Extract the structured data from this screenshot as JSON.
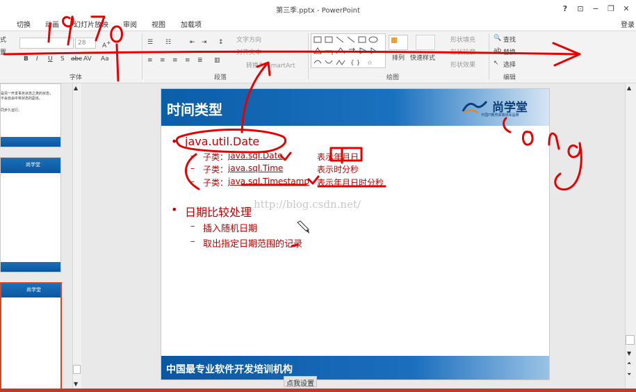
{
  "window": {
    "title": "第三季.pptx - PowerPoint",
    "help": "?",
    "login": "登录"
  },
  "tabs": [
    "切换",
    "动画",
    "幻灯片放映",
    "审阅",
    "视图",
    "加载项"
  ],
  "ribbon": {
    "font_size": "28",
    "left_cut_1": "式",
    "left_cut_2": "置",
    "group_labels": {
      "font": "字体",
      "paragraph": "段落",
      "drawing": "绘图",
      "editing": "编辑"
    },
    "paragraph": {
      "text_direction": "文字方向",
      "align_text": "对齐文本",
      "convert_smartart": "转换为 SmartArt"
    },
    "drawing": {
      "arrange": "排列",
      "quick_styles": "快速样式",
      "shape_fill": "形状填充",
      "shape_outline": "形状轮廓",
      "shape_effects": "形状效果"
    },
    "editing": {
      "find": "查找",
      "replace": "替换",
      "select": "选择"
    }
  },
  "slide": {
    "title": "时间类型",
    "logo_text": "尚学堂",
    "logo_sub": "中国IT教育高端领军品牌",
    "bullets": [
      {
        "text": "java.util.Date",
        "subs": [
          {
            "prefix": "子类：",
            "name": "java.sql.Date",
            "desc": "表示年月日"
          },
          {
            "prefix": "子类：",
            "name": "java.sql.Time",
            "desc": "表示时分秒"
          },
          {
            "prefix": "子类：",
            "name": "java.sql.Timestamp",
            "desc": "表示年月日时分秒"
          }
        ]
      },
      {
        "text": "日期比较处理",
        "subs": [
          {
            "text": "插入随机日期"
          },
          {
            "text": "取出指定日期范围的记录"
          }
        ]
      }
    ],
    "footer": "中国最专业软件开发培训机构"
  },
  "watermark": "http://blog.csdn.net/",
  "thumbs": {
    "t1_line1": "是另一开发事务状态之类的状态，",
    "t1_line2": "不会自会中将状态的副本。",
    "t1_line3": "同步久运行。"
  },
  "notes_button": "点我设置",
  "annotations": {
    "year": "1970",
    "word": "Long"
  },
  "colors": {
    "slide_blue": "#0b5ea8",
    "bullet_red": "#c00000",
    "ink_red": "#e60000"
  }
}
